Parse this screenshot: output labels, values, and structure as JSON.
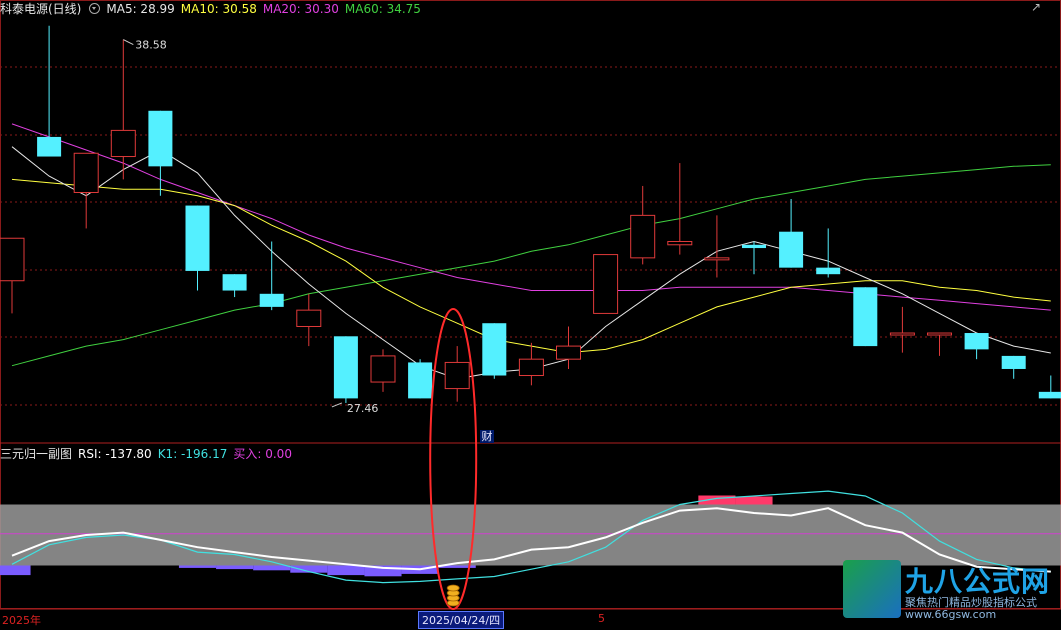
{
  "header": {
    "title": "科泰电源(日线)",
    "ma5": "MA5: 28.99",
    "ma10": "MA10: 30.58",
    "ma20": "MA20: 30.30",
    "ma60": "MA60: 34.75"
  },
  "sub_header": {
    "title": "三元归一副图",
    "rsi": "RSI: -137.80",
    "k1": "K1: -196.17",
    "buy": "买入: 0.00"
  },
  "colors": {
    "up": "#e03a3a",
    "down": "#54f0ff",
    "ma5": "#e6e6e6",
    "ma10": "#ffff40",
    "ma20": "#e040e0",
    "ma60": "#40d040",
    "rsi": "#ffffff",
    "k1": "#40e0e0",
    "band": "#9b9b9b",
    "mid": "#d040d0",
    "purple_fill": "#7a5cff",
    "pink_fill": "#ff3a6a",
    "grid": "#8a1a1a",
    "highlight": "#ff2a2a"
  },
  "annotations": {
    "high_label": "38.58",
    "low_label": "27.46",
    "marker_cai": "财"
  },
  "date_axis": {
    "year": "2025年",
    "cursor_date": "2025/04/24/四",
    "tick5": "5"
  },
  "watermark": {
    "brand": "九八公式网",
    "slogan": "聚焦热门精品炒股指标公式",
    "url": "www.66gsw.com"
  },
  "chart_data": {
    "type": "candlestick",
    "price_range": [
      27.0,
      39.3
    ],
    "candles": [
      {
        "o": 31.2,
        "h": 32.0,
        "l": 30.2,
        "c": 32.5
      },
      {
        "o": 35.6,
        "h": 39.0,
        "l": 35.0,
        "c": 35.0
      },
      {
        "o": 33.9,
        "h": 34.0,
        "l": 32.8,
        "c": 35.1
      },
      {
        "o": 35.0,
        "h": 38.58,
        "l": 34.3,
        "c": 35.8
      },
      {
        "o": 36.4,
        "h": 36.4,
        "l": 33.8,
        "c": 34.7
      },
      {
        "o": 33.5,
        "h": 33.5,
        "l": 30.9,
        "c": 31.5
      },
      {
        "o": 31.4,
        "h": 31.4,
        "l": 30.7,
        "c": 30.9
      },
      {
        "o": 30.8,
        "h": 32.4,
        "l": 30.3,
        "c": 30.4
      },
      {
        "o": 29.8,
        "h": 30.8,
        "l": 29.2,
        "c": 30.3
      },
      {
        "o": 29.5,
        "h": 29.5,
        "l": 27.46,
        "c": 27.6
      },
      {
        "o": 28.1,
        "h": 29.1,
        "l": 27.8,
        "c": 28.9
      },
      {
        "o": 28.7,
        "h": 28.8,
        "l": 27.6,
        "c": 27.6
      },
      {
        "o": 27.9,
        "h": 29.2,
        "l": 27.5,
        "c": 28.7
      },
      {
        "o": 29.9,
        "h": 29.9,
        "l": 28.2,
        "c": 28.3
      },
      {
        "o": 28.3,
        "h": 29.3,
        "l": 28.0,
        "c": 28.8
      },
      {
        "o": 28.8,
        "h": 29.8,
        "l": 28.5,
        "c": 29.2
      },
      {
        "o": 30.2,
        "h": 31.2,
        "l": 30.2,
        "c": 32.0
      },
      {
        "o": 31.9,
        "h": 34.1,
        "l": 31.7,
        "c": 33.2
      },
      {
        "o": 32.3,
        "h": 34.8,
        "l": 32.0,
        "c": 32.4
      },
      {
        "o": 31.9,
        "h": 33.2,
        "l": 31.3,
        "c": 31.9
      },
      {
        "o": 32.3,
        "h": 32.4,
        "l": 31.4,
        "c": 32.2
      },
      {
        "o": 32.7,
        "h": 33.7,
        "l": 32.7,
        "c": 31.6
      },
      {
        "o": 31.6,
        "h": 32.8,
        "l": 31.3,
        "c": 31.4
      },
      {
        "o": 31.0,
        "h": 31.0,
        "l": 29.3,
        "c": 29.2
      },
      {
        "o": 29.6,
        "h": 30.4,
        "l": 29.0,
        "c": 29.6
      },
      {
        "o": 29.6,
        "h": 29.6,
        "l": 28.9,
        "c": 29.6
      },
      {
        "o": 29.6,
        "h": 29.6,
        "l": 28.8,
        "c": 29.1
      },
      {
        "o": 28.9,
        "h": 28.9,
        "l": 28.2,
        "c": 28.5
      },
      {
        "o": 27.8,
        "h": 28.3,
        "l": 27.9,
        "c": 27.6
      }
    ],
    "ma5": [
      35.3,
      34.4,
      33.8,
      34.6,
      35.2,
      34.5,
      33.2,
      32.1,
      31.1,
      30.2,
      29.4,
      28.6,
      28.2,
      28.4,
      28.5,
      28.8,
      29.8,
      30.6,
      31.4,
      32.1,
      32.4,
      32.1,
      31.8,
      31.3,
      30.8,
      30.2,
      29.6,
      29.2,
      28.99
    ],
    "ma10": [
      34.3,
      34.2,
      34.1,
      34.0,
      34.0,
      33.8,
      33.5,
      32.9,
      32.4,
      31.8,
      31.0,
      30.4,
      29.9,
      29.4,
      29.2,
      29.0,
      29.1,
      29.4,
      29.9,
      30.4,
      30.7,
      31.0,
      31.1,
      31.2,
      31.2,
      31.0,
      30.9,
      30.7,
      30.58
    ],
    "ma20": [
      36.0,
      35.6,
      35.2,
      34.8,
      34.3,
      33.9,
      33.5,
      33.1,
      32.6,
      32.2,
      31.9,
      31.6,
      31.3,
      31.1,
      30.9,
      30.9,
      30.9,
      30.9,
      31.0,
      31.0,
      31.0,
      31.0,
      30.9,
      30.8,
      30.7,
      30.6,
      30.5,
      30.4,
      30.3
    ],
    "ma60": [
      28.6,
      28.9,
      29.2,
      29.4,
      29.7,
      30.0,
      30.3,
      30.5,
      30.8,
      31.0,
      31.2,
      31.4,
      31.6,
      31.8,
      32.1,
      32.3,
      32.6,
      32.9,
      33.1,
      33.4,
      33.7,
      33.9,
      34.1,
      34.3,
      34.4,
      34.5,
      34.6,
      34.7,
      34.75
    ],
    "oscillator": {
      "range": [
        0,
        100
      ],
      "band": [
        25,
        75
      ],
      "mid": 51,
      "rsi": [
        33,
        45,
        50,
        52,
        46,
        40,
        36,
        32,
        29,
        26,
        23,
        22,
        27,
        30,
        38,
        40,
        48,
        60,
        70,
        72,
        68,
        66,
        72,
        58,
        52,
        34,
        24,
        22,
        20
      ],
      "k1": [
        26,
        42,
        48,
        50,
        46,
        36,
        34,
        28,
        20,
        13,
        11,
        12,
        14,
        16,
        22,
        28,
        40,
        62,
        75,
        80,
        82,
        84,
        86,
        82,
        68,
        45,
        30,
        23,
        20
      ],
      "purple_hist": [
        -8,
        0,
        0,
        0,
        0,
        -2,
        -3,
        -4,
        -6,
        -8,
        -9,
        -7,
        -2,
        0,
        0,
        0,
        0,
        0,
        0,
        0,
        0,
        0,
        0,
        0,
        0,
        0,
        0,
        0,
        0
      ],
      "pink_hist": [
        0,
        0,
        0,
        0,
        0,
        0,
        0,
        0,
        0,
        0,
        0,
        0,
        0,
        0,
        0,
        0,
        0,
        0,
        0,
        9,
        8,
        0,
        0,
        0,
        0,
        0,
        0,
        0,
        0
      ]
    }
  }
}
